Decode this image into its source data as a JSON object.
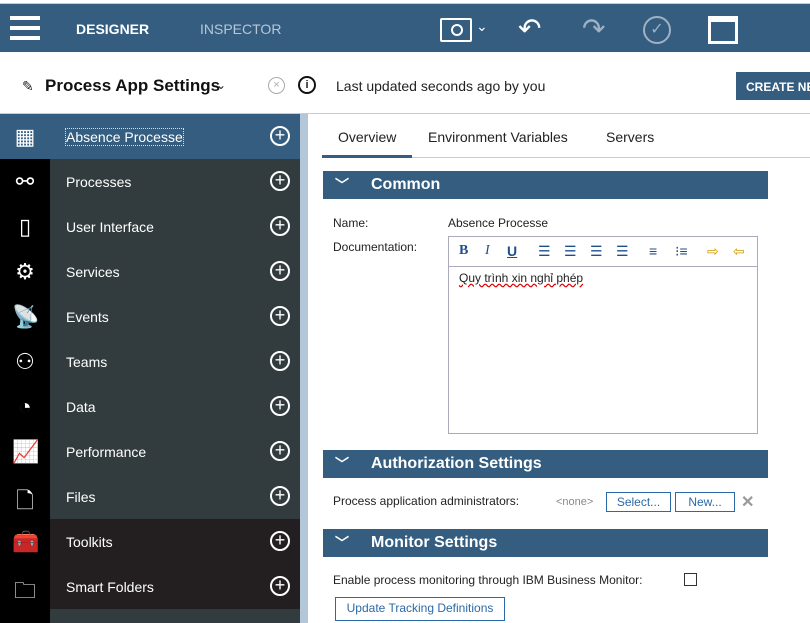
{
  "topbar": {
    "designer": "DESIGNER",
    "inspector": "INSPECTOR"
  },
  "subheader": {
    "title": "Process App Settings",
    "status": "Last updated seconds ago by you",
    "create": "CREATE NEW"
  },
  "sidebar": {
    "items": [
      {
        "label": "Absence Processe",
        "icon": "dashboard-icon"
      },
      {
        "label": "Processes",
        "icon": "process-icon"
      },
      {
        "label": "User Interface",
        "icon": "mobile-icon"
      },
      {
        "label": "Services",
        "icon": "gear-icon"
      },
      {
        "label": "Events",
        "icon": "satellite-icon"
      },
      {
        "label": "Teams",
        "icon": "team-icon"
      },
      {
        "label": "Data",
        "icon": "pie-icon"
      },
      {
        "label": "Performance",
        "icon": "chart-icon"
      },
      {
        "label": "Files",
        "icon": "file-icon"
      },
      {
        "label": "Toolkits",
        "icon": "toolbox-icon"
      },
      {
        "label": "Smart Folders",
        "icon": "folder-icon"
      }
    ]
  },
  "tabs": [
    "Overview",
    "Environment Variables",
    "Servers"
  ],
  "common": {
    "header": "Common",
    "name_label": "Name:",
    "name_value": "Absence Processe",
    "doc_label": "Documentation:",
    "doc_value": "Quy trình xin nghỉ phép"
  },
  "auth": {
    "header": "Authorization Settings",
    "label": "Process application administrators:",
    "value": "<none>",
    "select": "Select...",
    "new": "New..."
  },
  "monitor": {
    "header": "Monitor Settings",
    "label": "Enable process monitoring through IBM Business Monitor:",
    "button": "Update Tracking Definitions"
  },
  "colors": {
    "brand": "#345d80",
    "nav": "#323c3e"
  }
}
